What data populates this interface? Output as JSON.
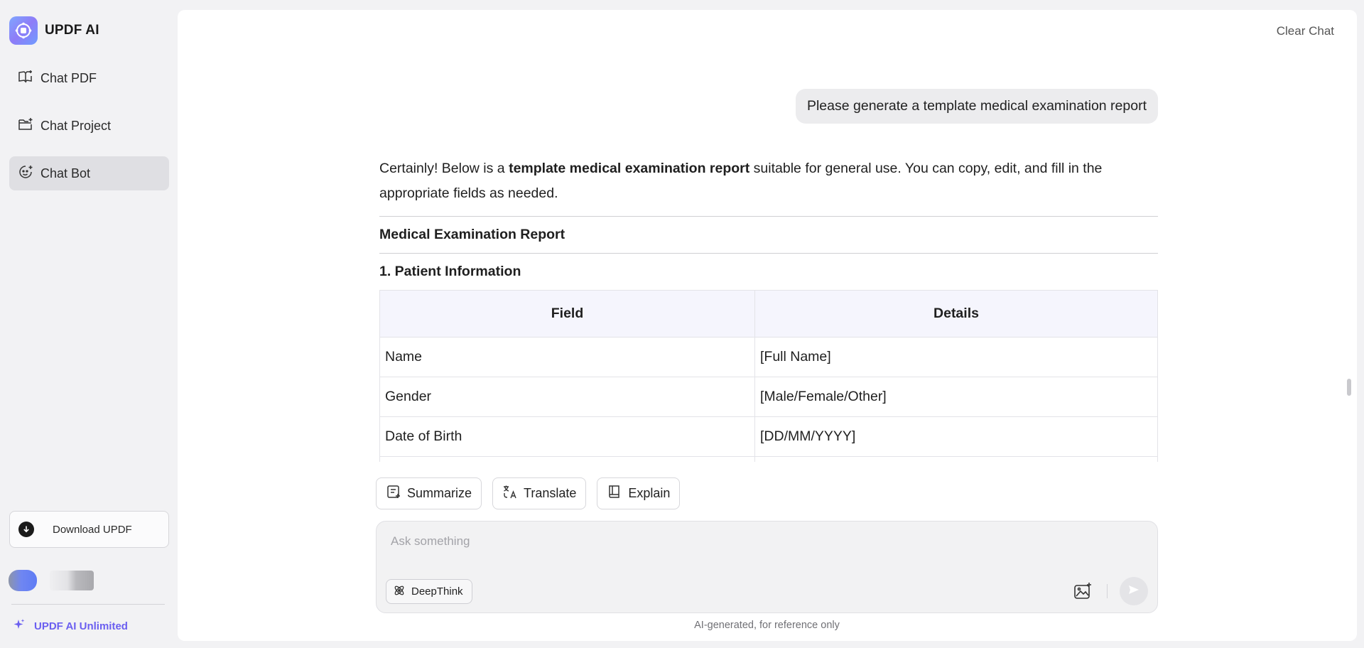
{
  "brand": {
    "name": "UPDF AI"
  },
  "sidebar": {
    "items": [
      {
        "label": "Chat PDF",
        "icon": "book-sparkle-icon"
      },
      {
        "label": "Chat Project",
        "icon": "folder-plus-icon"
      },
      {
        "label": "Chat Bot",
        "icon": "bot-face-icon",
        "active": true
      }
    ],
    "download_label": "Download UPDF",
    "unlimited_label": "UPDF AI Unlimited"
  },
  "header": {
    "clear_chat": "Clear Chat"
  },
  "chat": {
    "user_message": "Please generate a template medical examination report",
    "intro_pre": "Certainly! Below is a ",
    "intro_bold": "template medical examination report",
    "intro_post": " suitable for general use. You can copy, edit, and fill in the appropriate fields as needed.",
    "report_title": "Medical Examination Report",
    "section_title": "1. Patient Information",
    "table": {
      "headers": [
        "Field",
        "Details"
      ],
      "rows": [
        [
          "Name",
          "[Full Name]"
        ],
        [
          "Gender",
          "[Male/Female/Other]"
        ],
        [
          "Date of Birth",
          "[DD/MM/YYYY]"
        ],
        [
          "",
          ""
        ]
      ]
    }
  },
  "quick_actions": [
    {
      "label": "Summarize",
      "icon": "summarize-icon"
    },
    {
      "label": "Translate",
      "icon": "translate-icon"
    },
    {
      "label": "Explain",
      "icon": "book-icon"
    }
  ],
  "composer": {
    "placeholder": "Ask something",
    "value": "",
    "deepthink_label": "DeepThink"
  },
  "footnote": "AI-generated, for reference only",
  "colors": {
    "accent": "#6b5ff0",
    "active_nav": "#dfdfe3",
    "table_header_bg": "#f5f5fd"
  }
}
